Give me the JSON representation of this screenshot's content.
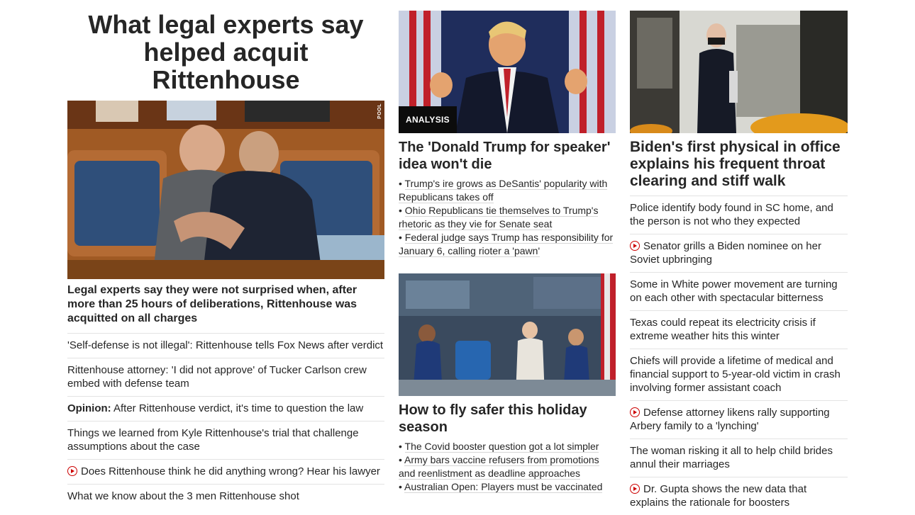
{
  "lead": {
    "headline": "What legal experts say helped acquit Rittenhouse",
    "photo_credit": "POOL",
    "summary": "Legal experts say they were not surprised when, after more than 25 hours of deliberations, Rittenhouse was acquitted on all charges",
    "stories": [
      {
        "text": "'Self-defense is not illegal': Rittenhouse tells Fox News after verdict",
        "video": false
      },
      {
        "text": "Rittenhouse attorney: 'I did not approve' of Tucker Carlson crew embed with defense team",
        "video": false
      },
      {
        "prefix": "Opinion:",
        "text": " After Rittenhouse verdict, it's time to question the law",
        "video": false
      },
      {
        "text": "Things we learned from Kyle Rittenhouse's trial that challenge assumptions about the case",
        "video": false
      },
      {
        "text": "Does Rittenhouse think he did anything wrong? Hear his lawyer",
        "video": true
      },
      {
        "text": "What we know about the 3 men Rittenhouse shot",
        "video": false
      }
    ]
  },
  "trump_card": {
    "badge": "ANALYSIS",
    "headline": "The 'Donald Trump for speaker' idea won't die",
    "bullets": [
      "Trump's ire grows as DeSantis' popularity with Republicans takes off",
      "Ohio Republicans tie themselves to Trump's rhetoric as they vie for Senate seat",
      "Federal judge says Trump has responsibility for January 6, calling rioter a 'pawn'"
    ]
  },
  "travel_card": {
    "headline": "How to fly safer this holiday season",
    "bullets": [
      "The Covid booster question got a lot simpler",
      "Army bars vaccine refusers from promotions and reenlistment as deadline approaches",
      "Australian Open: Players must be vaccinated"
    ]
  },
  "biden_card": {
    "headline": "Biden's first physical in office explains his frequent throat clearing and stiff walk",
    "stories": [
      {
        "text": "Police identify body found in SC home, and the person is not who they expected",
        "video": false
      },
      {
        "text": "Senator grills a Biden nominee on her Soviet upbringing",
        "video": true
      },
      {
        "text": "Some in White power movement are turning on each other with spectacular bitterness",
        "video": false
      },
      {
        "text": "Texas could repeat its electricity crisis if extreme weather hits this winter",
        "video": false
      },
      {
        "text": "Chiefs will provide a lifetime of medical and financial support to 5-year-old victim in crash involving former assistant coach",
        "video": false
      },
      {
        "text": "Defense attorney likens rally supporting Arbery family to a 'lynching'",
        "video": true
      },
      {
        "text": "The woman risking it all to help child brides annul their marriages",
        "video": false
      },
      {
        "text": "Dr. Gupta shows the new data that explains the rationale for boosters",
        "video": true
      }
    ]
  },
  "colors": {
    "accent_red": "#cc0000",
    "text": "#262626",
    "divider": "#e3e3e3",
    "badge_bg": "#0c0c0c"
  }
}
